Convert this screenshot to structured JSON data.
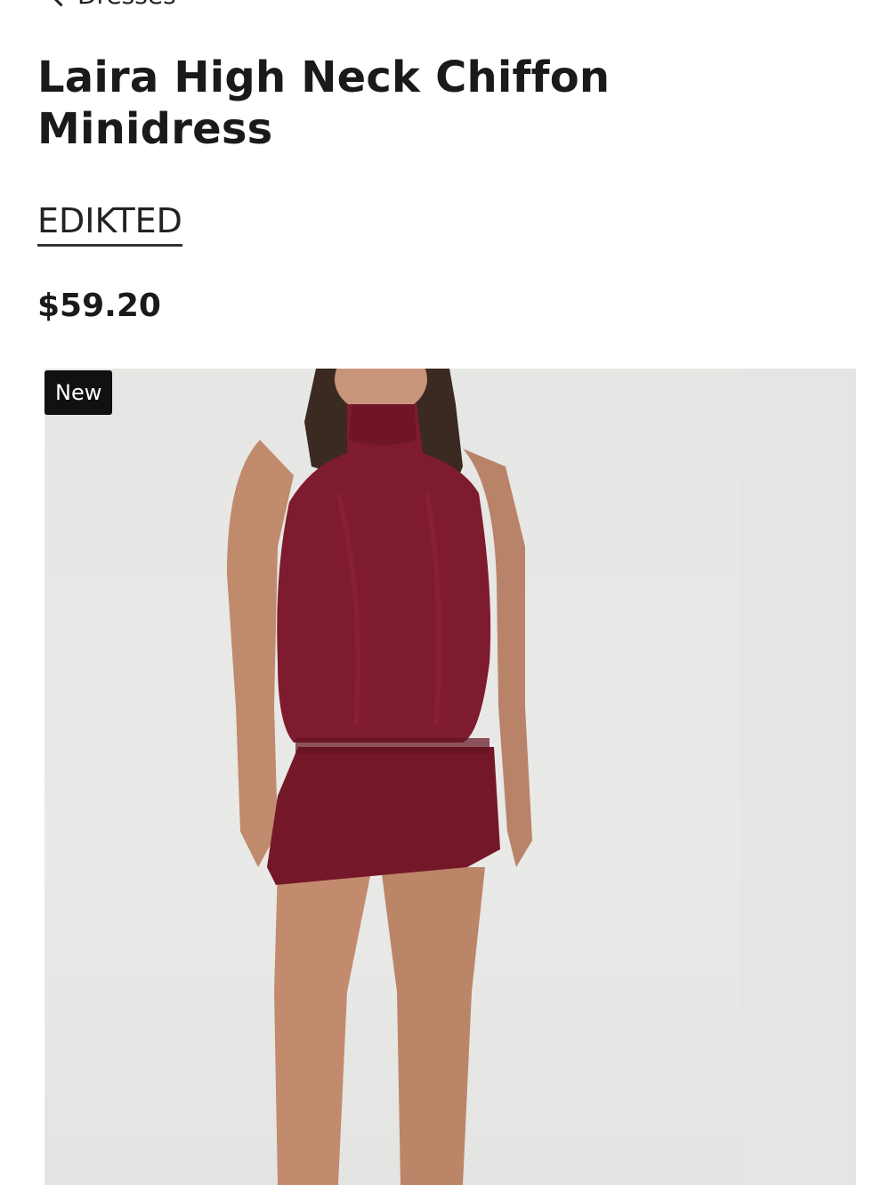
{
  "nav": {
    "back_label": "Dresses"
  },
  "product": {
    "title_line1": "Laira High Neck Chiffon",
    "title_line2": "Minidress",
    "brand": "EDIKTED",
    "price": "$59.20",
    "badge": "New"
  },
  "gallery": {
    "main_image_alt": "Laira High Neck Chiffon Minidress",
    "dress_color": "#7e1b2e",
    "background_color": "#e7e7e5"
  }
}
